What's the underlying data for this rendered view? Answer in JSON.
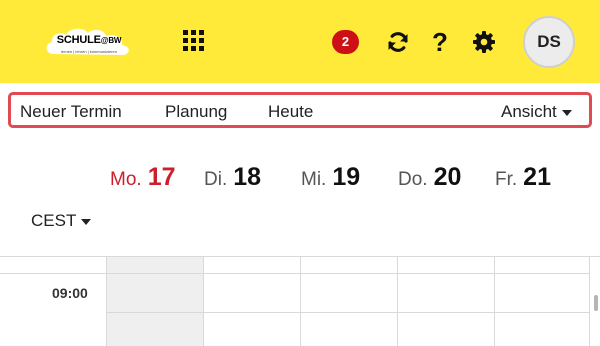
{
  "header": {
    "logo_title": "SCHULE",
    "logo_suffix": "@BW",
    "logo_subtitle": "lernen | lehren | kommunizieren",
    "notifications_count": "2",
    "avatar_initials": "DS",
    "icons": [
      "apps-grid-icon",
      "sync-icon",
      "help-icon",
      "settings-gear-icon"
    ],
    "accent_color": "#ffea3a",
    "badge_color": "#cc1016"
  },
  "toolbar": {
    "new_appointment": "Neuer Termin",
    "planning": "Planung",
    "today": "Heute",
    "view": "Ansicht",
    "highlight_color": "#e04a52"
  },
  "days": [
    {
      "name": "Mo.",
      "date": "17",
      "today": true
    },
    {
      "name": "Di.",
      "date": "18"
    },
    {
      "name": "Mi.",
      "date": "19"
    },
    {
      "name": "Do.",
      "date": "20"
    },
    {
      "name": "Fr.",
      "date": "21"
    }
  ],
  "timezone": {
    "label": "CEST"
  },
  "grid": {
    "time_label": "09:00",
    "today_color": "#cc1e2b"
  }
}
